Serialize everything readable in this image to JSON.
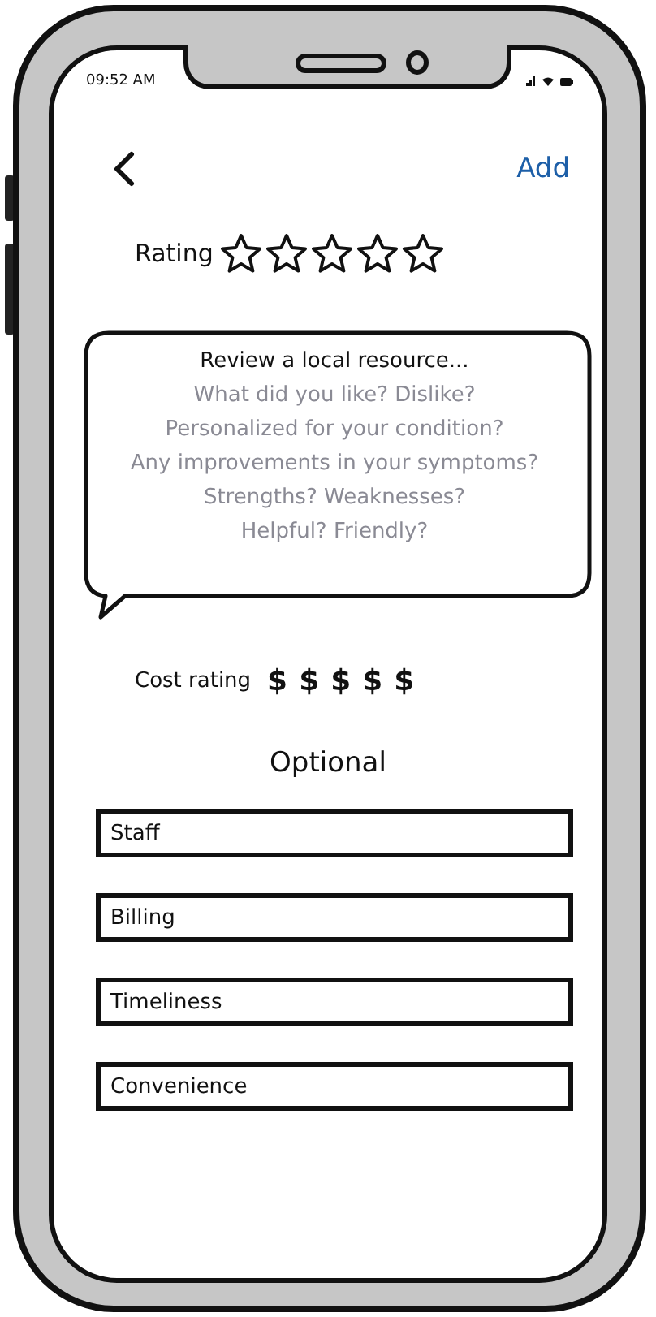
{
  "status_bar": {
    "time": "09:52 AM"
  },
  "nav": {
    "action": "Add"
  },
  "rating": {
    "label": "Rating",
    "stars": 0
  },
  "prompt": {
    "title": "Review a local resource...",
    "lines": [
      "What did you like? Dislike?",
      "Personalized for your condition?",
      "Any improvements in your symptoms?",
      "Strengths? Weaknesses?",
      "Helpful? Friendly?"
    ]
  },
  "cost_rating": {
    "label": "Cost rating",
    "signs": [
      "$",
      "$",
      "$",
      "$",
      "$"
    ]
  },
  "optional": {
    "heading": "Optional",
    "fields": [
      {
        "value": "Staff"
      },
      {
        "value": "Billing"
      },
      {
        "value": "Timeliness"
      },
      {
        "value": "Convenience"
      }
    ]
  }
}
